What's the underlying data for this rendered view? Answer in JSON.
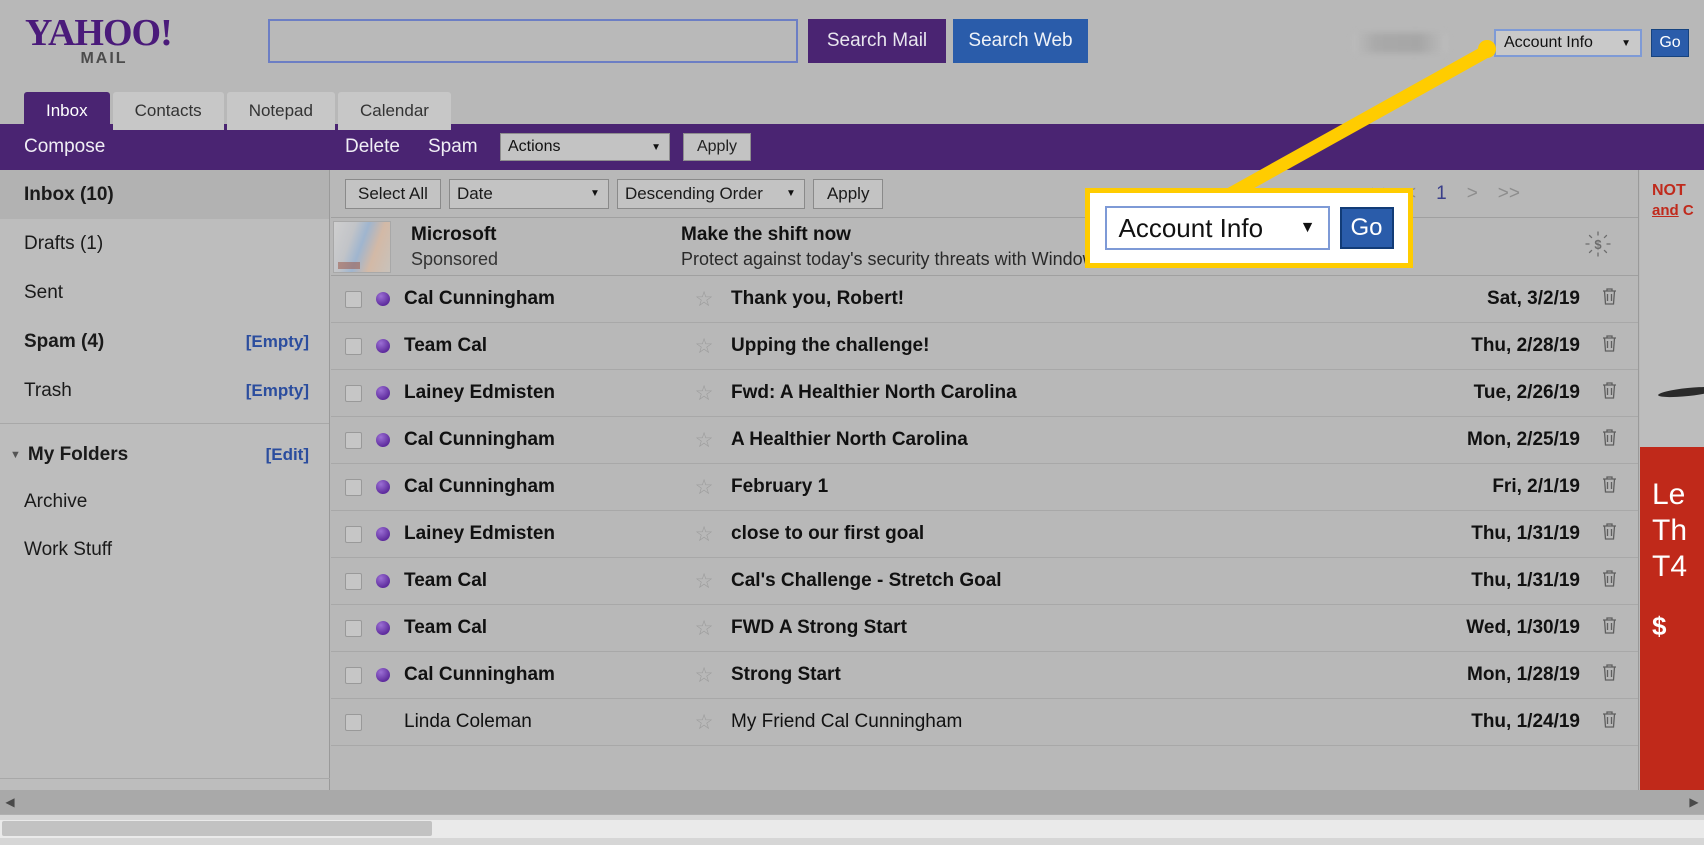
{
  "header": {
    "logo_main": "YAHOO!",
    "logo_sub": "MAIL",
    "search_placeholder": "",
    "search_value": "",
    "search_mail_label": "Search Mail",
    "search_web_label": "Search Web",
    "account_select_value": "Account Info",
    "go_label": "Go",
    "caret": "▼"
  },
  "tabs": [
    {
      "label": "Inbox",
      "active": true
    },
    {
      "label": "Contacts",
      "active": false
    },
    {
      "label": "Notepad",
      "active": false
    },
    {
      "label": "Calendar",
      "active": false
    }
  ],
  "toolbar": {
    "compose_label": "Compose",
    "delete_label": "Delete",
    "spam_label": "Spam",
    "actions_value": "Actions",
    "apply_label": "Apply"
  },
  "sidebar": {
    "folders": [
      {
        "name": "Inbox (10)",
        "action": "",
        "bold": true,
        "selected": true
      },
      {
        "name": "Drafts (1)",
        "action": "",
        "bold": false,
        "selected": false
      },
      {
        "name": "Sent",
        "action": "",
        "bold": false,
        "selected": false
      },
      {
        "name": "Spam (4)",
        "action": "[Empty]",
        "bold": true,
        "selected": false
      },
      {
        "name": "Trash",
        "action": "[Empty]",
        "bold": false,
        "selected": false
      }
    ],
    "my_folders_label": "My Folders",
    "my_folders_edit": "[Edit]",
    "triangle": "▼",
    "sub_folders": [
      {
        "name": "Archive"
      },
      {
        "name": "Work Stuff"
      }
    ]
  },
  "listbar": {
    "select_all_label": "Select All",
    "sort_field_value": "Date",
    "sort_order_value": "Descending Order",
    "apply_label": "Apply",
    "caret": "▼",
    "pager": {
      "first": "<<",
      "prev": "<",
      "current": "1",
      "next": ">",
      "last": ">>"
    }
  },
  "sponsored_row": {
    "sender": "Microsoft",
    "sender_sub": "Sponsored",
    "subject": "Make the shift now",
    "preview": "Protect against today's security threats with Windows 10 Pro devices, the",
    "money_icon": "$"
  },
  "emails": [
    {
      "sender": "Cal Cunningham",
      "subject": "Thank you, Robert!",
      "date": "Sat, 3/2/19",
      "unread": true
    },
    {
      "sender": "Team Cal",
      "subject": "Upping the challenge!",
      "date": "Thu, 2/28/19",
      "unread": true
    },
    {
      "sender": "Lainey Edmisten",
      "subject": "Fwd: A Healthier North Carolina",
      "date": "Tue, 2/26/19",
      "unread": true
    },
    {
      "sender": "Cal Cunningham",
      "subject": "A Healthier North Carolina",
      "date": "Mon, 2/25/19",
      "unread": true
    },
    {
      "sender": "Cal Cunningham",
      "subject": "February 1",
      "date": "Fri, 2/1/19",
      "unread": true
    },
    {
      "sender": "Lainey Edmisten",
      "subject": "close to our first goal",
      "date": "Thu, 1/31/19",
      "unread": true
    },
    {
      "sender": "Team Cal",
      "subject": "Cal's Challenge - Stretch Goal",
      "date": "Thu, 1/31/19",
      "unread": true
    },
    {
      "sender": "Team Cal",
      "subject": "FWD A Strong Start",
      "date": "Wed, 1/30/19",
      "unread": true
    },
    {
      "sender": "Cal Cunningham",
      "subject": "Strong Start",
      "date": "Mon, 1/28/19",
      "unread": true
    },
    {
      "sender": "Linda Coleman",
      "subject": "My Friend Cal Cunningham",
      "date": "Thu, 1/24/19",
      "unread": false
    }
  ],
  "ad_panel": {
    "line1": "NOT",
    "line2_u": "and",
    "line2_rest": " C",
    "red_line1": "Le",
    "red_line2": "Th",
    "red_line3": "T4",
    "price": "$"
  },
  "callout": {
    "select_value": "Account Info",
    "caret": "▼",
    "go_label": "Go",
    "border_color": "#ffcc00"
  },
  "icons": {
    "trash": "🗑",
    "star": "★",
    "scroll_left": "◀",
    "scroll_right": "▶"
  }
}
